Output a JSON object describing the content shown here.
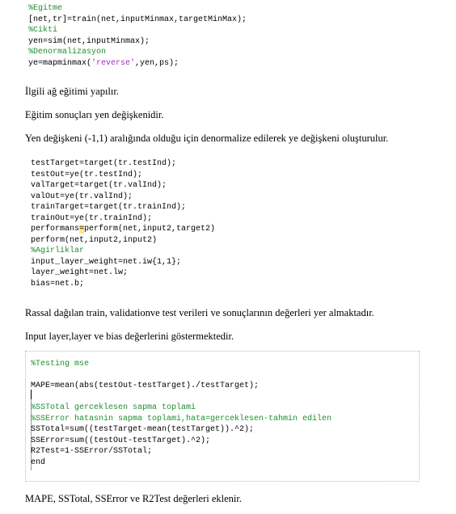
{
  "code_block_1": [
    [
      {
        "t": "%Egitme",
        "c": "cm"
      }
    ],
    [
      {
        "t": "[net,tr]=train(net,inputMinmax,targetMinMax);"
      }
    ],
    [
      {
        "t": "%Cikti",
        "c": "cm"
      }
    ],
    [
      {
        "t": "yen=sim(net,inputMinmax);"
      }
    ],
    [
      {
        "t": "%Denormalizasyon",
        "c": "cm"
      }
    ],
    [
      {
        "t": "ye=mapminmax("
      },
      {
        "t": "'reverse'",
        "c": "str"
      },
      {
        "t": ",yen,ps);"
      }
    ]
  ],
  "paragraphs_1": [
    "İlgili ağ eğitimi yapılır.",
    "Eğitim sonuçları yen değişkenidir.",
    "Yen değişkeni (-1,1) aralığında olduğu için denormalize edilerek ye değişkeni oluşturulur."
  ],
  "code_block_2": [
    [
      {
        "t": "testTarget=target(tr.testInd);"
      }
    ],
    [
      {
        "t": "testOut=ye(tr.testInd);"
      }
    ],
    [
      {
        "t": "valTarget=target(tr.valInd);"
      }
    ],
    [
      {
        "t": "valOut=ye(tr.valInd);"
      }
    ],
    [
      {
        "t": "trainTarget=target(tr.trainInd);"
      }
    ],
    [
      {
        "t": "trainOut=ye(tr.trainInd);"
      }
    ],
    [
      {
        "t": "performans"
      },
      {
        "t": "=",
        "c": "hl"
      },
      {
        "t": "perform(net,input2,target2)"
      }
    ],
    [
      {
        "t": "perform(net,input2,input2)"
      }
    ],
    [
      {
        "t": "%Agirliklar",
        "c": "cm"
      }
    ],
    [
      {
        "t": "input_layer_weight=net.iw{1,1};"
      }
    ],
    [
      {
        "t": "layer_weight=net.lw;"
      }
    ],
    [
      {
        "t": "bias=net.b;"
      }
    ]
  ],
  "paragraphs_2": [
    "Rassal dağılan train, validationve test verileri ve sonuçlarının değerleri yer almaktadır.",
    "Input layer,layer ve bias değerlerini göstermektedir."
  ],
  "code_block_3": [
    [
      {
        "t": "%Testing mse",
        "c": "cm"
      }
    ],
    [
      {
        "t": ""
      }
    ],
    [
      {
        "t": "MAPE=mean(abs(testOut-testTarget)./testTarget);"
      }
    ],
    [
      {
        "t": ""
      }
    ],
    [
      {
        "t": "%SSTotal gerceklesen sapma toplami",
        "c": "cm"
      }
    ],
    [
      {
        "t": "%SSError hatasnin sapma toplami,hata=gerceklesen-tahmin edilen",
        "c": "cm"
      }
    ],
    [
      {
        "t": "SSTotal=sum((testTarget-mean(testTarget)).^2);"
      }
    ],
    [
      {
        "t": "SSError=sum((testOut-testTarget).^2);"
      }
    ],
    [
      {
        "t": "R2Test=1-SSError/SSTotal;"
      }
    ],
    [
      {
        "t": "end"
      }
    ]
  ],
  "paragraphs_3": [
    "MAPE, SSTotal, SSError ve R2Test değerleri eklenir."
  ]
}
